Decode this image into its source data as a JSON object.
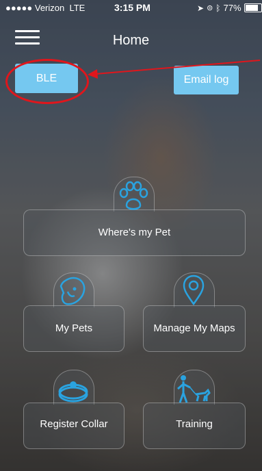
{
  "status_bar": {
    "carrier": "●●●●● Verizon",
    "network": "LTE",
    "time": "3:15 PM",
    "battery": "77%",
    "battery_level": 0.77
  },
  "nav": {
    "title": "Home"
  },
  "buttons": {
    "ble": "BLE",
    "email_log": "Email log"
  },
  "tiles": {
    "wheres_pet": "Where's my Pet",
    "my_pets": "My Pets",
    "manage_maps": "Manage My Maps",
    "register_collar": "Register Collar",
    "training": "Training"
  },
  "colors": {
    "accent": "#2aa3e0",
    "button": "#75c8f0",
    "annotation": "#e0161c"
  },
  "icons": [
    "menu-icon",
    "paw-icon",
    "dog-face-icon",
    "map-pin-icon",
    "collar-icon",
    "training-icon",
    "location-arrow-icon",
    "wifi-icon",
    "bluetooth-icon",
    "battery-icon"
  ]
}
